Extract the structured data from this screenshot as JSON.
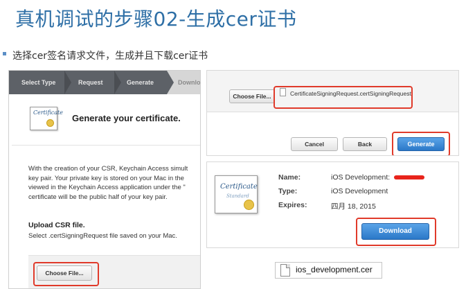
{
  "slide": {
    "title": "真机调试的步骤02-生成cer证书",
    "subtitle": "选择cer签名请求文件，生成并且下载cer证书"
  },
  "left_panel": {
    "steps": [
      "Select Type",
      "Request",
      "Generate",
      "Downlo"
    ],
    "certificate_icon_text": "Certificate",
    "heading": "Generate your certificate.",
    "body_lines": [
      "With the creation of your CSR, Keychain Access simult",
      "key pair. Your private key is stored on your Mac in the",
      "viewed in the Keychain Access application under the \"",
      "certificate will be the public half of your key pair."
    ],
    "upload_heading": "Upload CSR file.",
    "upload_desc": "Select .certSigningRequest file saved on your Mac.",
    "choose_file_label": "Choose File..."
  },
  "right_top": {
    "choose_file_label": "Choose File...",
    "file_name": "CertificateSigningRequest.certSigningRequest",
    "cancel_label": "Cancel",
    "back_label": "Back",
    "generate_label": "Generate"
  },
  "right_mid": {
    "certificate_icon_text": "Certificate",
    "certificate_icon_subtext": "Standard",
    "name_label": "Name:",
    "name_value": "iOS Development:",
    "type_label": "Type:",
    "type_value": "iOS Development",
    "expires_label": "Expires:",
    "expires_value": "四月 18, 2015",
    "download_label": "Download"
  },
  "downloaded_file": {
    "name": "ios_development.cer"
  },
  "colors": {
    "title": "#2e6fa6",
    "highlight": "#e03a2a",
    "primary_button": "#2b78c8"
  }
}
